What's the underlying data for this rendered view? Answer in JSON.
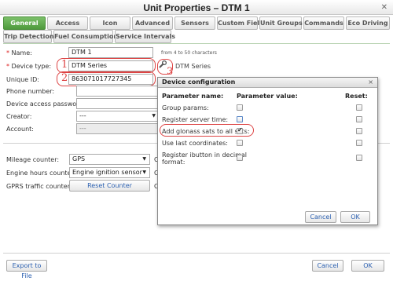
{
  "window": {
    "title": "Unit Properties – DTM 1"
  },
  "tabs_row1": [
    "General",
    "Access",
    "Icon",
    "Advanced",
    "Sensors",
    "Custom Fields",
    "Unit Groups",
    "Commands",
    "Eco Driving"
  ],
  "tabs_row2": [
    "Trip Detection",
    "Fuel Consumption",
    "Service Intervals"
  ],
  "active_tab": "General",
  "form": {
    "name_label": "Name:",
    "name_value": "DTM 1",
    "name_hint": "from 4 to 50 characters",
    "device_type_label": "Device type:",
    "device_type_value": "DTM Series",
    "device_type_side": "DTM Series",
    "unique_id_label": "Unique ID:",
    "unique_id_value": "863071017727345",
    "phone_label": "Phone number:",
    "phone_value": "",
    "password_label": "Device access password:",
    "password_value": "",
    "creator_label": "Creator:",
    "creator_value": "---",
    "account_label": "Account:",
    "account_value": "---"
  },
  "counters": {
    "mileage_label": "Mileage counter:",
    "mileage_value": "GPS",
    "engine_label": "Engine hours counter:",
    "engine_value": "Engine ignition sensor",
    "gprs_label": "GPRS traffic counter:",
    "gprs_button": "Reset Counter",
    "side_letter": "C"
  },
  "annotations": {
    "n1": "1",
    "n2": "2",
    "n3": "3"
  },
  "dialog": {
    "title": "Device configuration",
    "col_name": "Parameter name:",
    "col_value": "Parameter value:",
    "col_reset": "Reset:",
    "rows": [
      {
        "name": "Group params:",
        "checked": false
      },
      {
        "name": "Register server time:",
        "checked": false
      },
      {
        "name": "Add glonass sats to all sats:",
        "checked": true
      },
      {
        "name": "Use last coordinates:",
        "checked": false
      },
      {
        "name": "Register ibutton in decimal",
        "name2": "format:",
        "checked": false
      }
    ],
    "cancel": "Cancel",
    "ok": "OK"
  },
  "footer": {
    "export": "Export to File",
    "cancel": "Cancel",
    "ok": "OK"
  },
  "colors": {
    "tab_active": "#5aa646",
    "link": "#2a5fb0",
    "annotation": "#d44444"
  }
}
